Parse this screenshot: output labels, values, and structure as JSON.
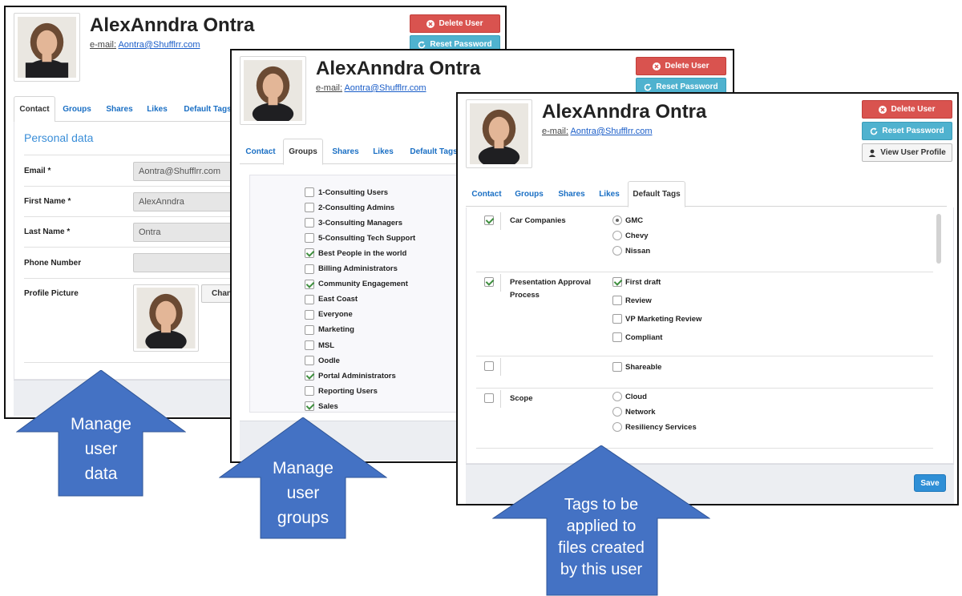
{
  "user": {
    "name": "AlexAnndra Ontra",
    "email_label": "e-mail:",
    "email": "Aontra@Shufflrr.com"
  },
  "buttons": {
    "delete": "Delete User",
    "reset": "Reset Password",
    "view_profile": "View User Profile",
    "save": "Save",
    "change_short": "Chan"
  },
  "tabs": [
    "Contact",
    "Groups",
    "Shares",
    "Likes",
    "Default Tags"
  ],
  "contact": {
    "section_title": "Personal data",
    "fields": [
      {
        "label": "Email *",
        "value": "Aontra@Shufflrr.com"
      },
      {
        "label": "First Name *",
        "value": "AlexAnndra"
      },
      {
        "label": "Last Name *",
        "value": "Ontra"
      },
      {
        "label": "Phone Number",
        "value": ""
      },
      {
        "label": "Profile Picture",
        "value": ""
      }
    ]
  },
  "groups": [
    {
      "label": "1-Consulting Users",
      "checked": false
    },
    {
      "label": "2-Consulting Admins",
      "checked": false
    },
    {
      "label": "3-Consulting Managers",
      "checked": false
    },
    {
      "label": "5-Consulting Tech Support",
      "checked": false
    },
    {
      "label": "Best People in the world",
      "checked": true
    },
    {
      "label": "Billing Administrators",
      "checked": false
    },
    {
      "label": "Community Engagement",
      "checked": true
    },
    {
      "label": "East Coast",
      "checked": false
    },
    {
      "label": "Everyone",
      "checked": false
    },
    {
      "label": "Marketing",
      "checked": false
    },
    {
      "label": "MSL",
      "checked": false
    },
    {
      "label": "Oodle",
      "checked": false
    },
    {
      "label": "Portal Administrators",
      "checked": true
    },
    {
      "label": "Reporting Users",
      "checked": false
    },
    {
      "label": "Sales",
      "checked": true
    }
  ],
  "default_tags": [
    {
      "name": "Car Companies",
      "checked": true,
      "type": "radio",
      "options": [
        {
          "label": "GMC",
          "selected": true
        },
        {
          "label": "Chevy",
          "selected": false
        },
        {
          "label": "Nissan",
          "selected": false
        }
      ]
    },
    {
      "name": "Presentation Approval Process",
      "checked": true,
      "type": "checkbox",
      "options": [
        {
          "label": "First draft",
          "selected": true
        },
        {
          "label": "Review",
          "selected": false
        },
        {
          "label": "VP Marketing Review",
          "selected": false
        },
        {
          "label": "Compliant",
          "selected": false
        }
      ]
    },
    {
      "name": "",
      "checked": false,
      "type": "checkbox",
      "options": [
        {
          "label": "Shareable",
          "selected": false
        }
      ]
    },
    {
      "name": "Scope",
      "checked": false,
      "type": "radio",
      "options": [
        {
          "label": "Cloud",
          "selected": false
        },
        {
          "label": "Network",
          "selected": false
        },
        {
          "label": "Resiliency Services",
          "selected": false
        }
      ]
    }
  ],
  "callouts": {
    "one": [
      "Manage",
      "user",
      "data"
    ],
    "two": [
      "Manage",
      "user",
      "groups"
    ],
    "three": [
      "Tags to be",
      "applied to",
      "files created",
      "by this user"
    ]
  },
  "colors": {
    "arrow_fill": "#4472c4",
    "delete_red": "#d9534f",
    "reset_teal": "#4fb2cf",
    "save_blue": "#2f8fd6",
    "link_blue": "#1a6fc4",
    "section_blue": "#3a8ed8"
  }
}
